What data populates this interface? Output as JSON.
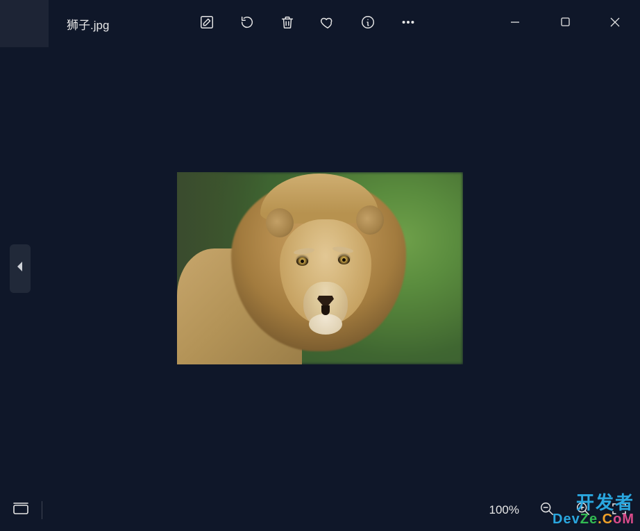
{
  "filename": "狮子.jpg",
  "toolbar": {
    "edit": "Edit",
    "rotate": "Rotate",
    "delete": "Delete",
    "favorite": "Favorite",
    "info": "Info",
    "more": "More"
  },
  "window": {
    "minimize": "Minimize",
    "maximize": "Maximize",
    "close": "Close"
  },
  "nav": {
    "previous": "Previous"
  },
  "bottombar": {
    "filmstrip": "Filmstrip",
    "zoom_label": "100%",
    "zoom_out": "Zoom out",
    "zoom_in": "Zoom in",
    "fit": "Fit to window"
  },
  "watermark": {
    "line1": "开发者",
    "line2": "DevZe.CoM"
  }
}
